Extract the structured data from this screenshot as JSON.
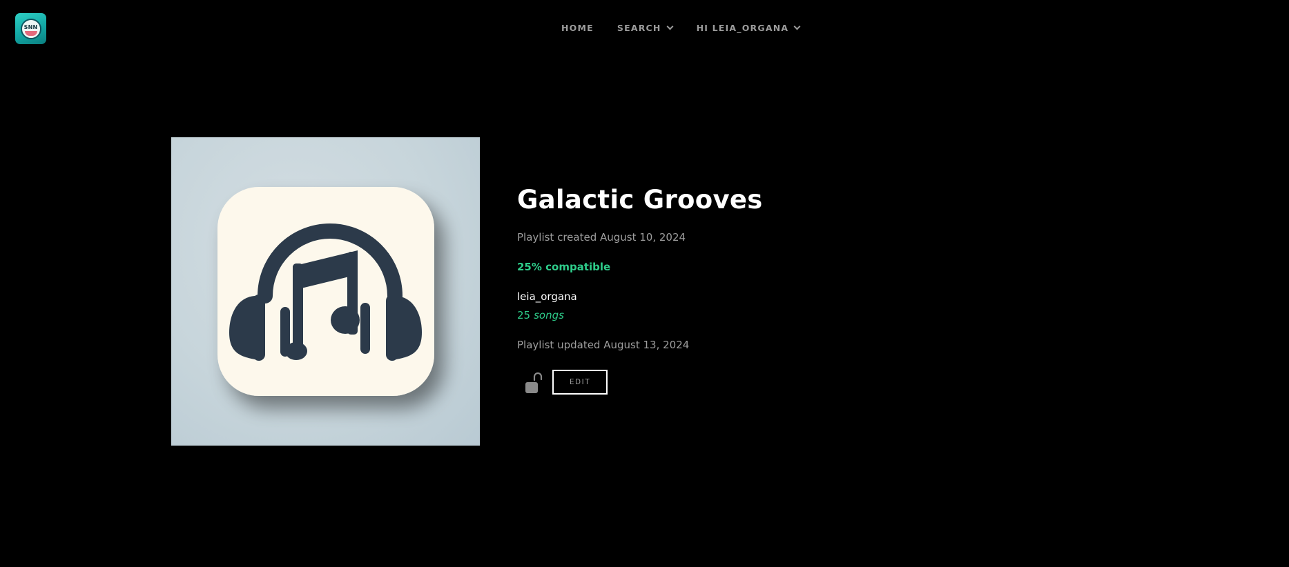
{
  "header": {
    "logo_text": "SNN",
    "nav": {
      "home": "HOME",
      "search": "SEARCH",
      "user": "HI LEIA_ORGANA"
    }
  },
  "playlist": {
    "cover_icon": "headphones-music-note-icon",
    "title": "Galactic Grooves",
    "created": "Playlist created August 10, 2024",
    "compatibility": "25% compatible",
    "owner": "leia_organa",
    "song_count": "25",
    "song_unit": "songs",
    "updated": "Playlist updated August 13, 2024",
    "lock_icon": "unlocked-padlock-icon",
    "edit_label": "EDIT"
  },
  "colors": {
    "background": "#000000",
    "accent_green": "#2ecc8a",
    "muted_text": "#9e9e9e",
    "cover_background": "#c7d5db",
    "cover_tile": "#fdf8ec",
    "icon_dark": "#2c3a4a"
  }
}
